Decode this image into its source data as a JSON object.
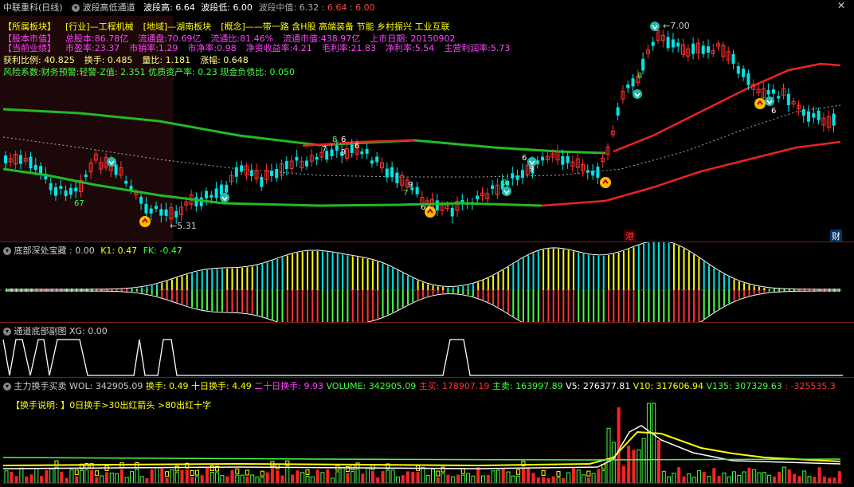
{
  "header": {
    "title": "中联重科(日线)",
    "indicator_name": "波段高低通道",
    "wave_high_label": "波段高:",
    "wave_high_value": "6.64",
    "wave_low_label": "波段低:",
    "wave_low_value": "6.00",
    "wave_mid_label": "波段中值:",
    "wave_mid_value_a": "6.32",
    "wave_mid_sep": ":",
    "wave_mid_value_b": "6.64",
    "wave_mid_sep2": ":",
    "wave_mid_value_c": "6.00"
  },
  "info": {
    "row1": [
      {
        "text": "【所属板块】",
        "color": "#ffff00"
      },
      {
        "text": "[行业]—工程机械",
        "color": "#ffff00"
      },
      {
        "text": "[地域]—湖南板块",
        "color": "#ffff00"
      },
      {
        "text": "[概念]——带一路 含H股 高端装备 节能 乡村振兴 工业互联",
        "color": "#ffff00"
      }
    ],
    "row2": [
      {
        "text": "【股本市值】",
        "color": "#ff44ff"
      },
      {
        "text": "总股本:86.78亿",
        "color": "#ff44ff"
      },
      {
        "text": "流通盘:70.69亿",
        "color": "#ff44ff"
      },
      {
        "text": "流通比:81.46%",
        "color": "#ff44ff"
      },
      {
        "text": "流通市值:438.97亿",
        "color": "#ff44ff"
      },
      {
        "text": "上市日期: 20150902",
        "color": "#ff44ff"
      }
    ],
    "row3": [
      {
        "text": "【当前业绩】",
        "color": "#ff44ff"
      },
      {
        "text": "市盈率:23.37",
        "color": "#ff44ff"
      },
      {
        "text": "市销率:1.29",
        "color": "#ff44ff"
      },
      {
        "text": "市净率:0.98",
        "color": "#ff44ff"
      },
      {
        "text": "净资收益率:4.21",
        "color": "#ff44ff"
      },
      {
        "text": "毛利率:21.83",
        "color": "#ff44ff"
      },
      {
        "text": "净利率:5.54",
        "color": "#ff44ff"
      },
      {
        "text": "主营利润率:5.73",
        "color": "#ff44ff"
      }
    ],
    "row4": [
      {
        "text": "获利比例: 40.825",
        "color": "#ffff88"
      },
      {
        "text": "换手: 0.485",
        "color": "#ffff88"
      },
      {
        "text": "量比: 1.181",
        "color": "#ffff88"
      },
      {
        "text": "涨幅: 0.648",
        "color": "#ffff88"
      }
    ],
    "row5": "风险系数:财务预警:轻警-Z值: 2.351 优质资产率: 0.23 现金负债比: 0.050"
  },
  "main_chart": {
    "high_label": "7.00",
    "low_label": "5.31",
    "badge_hk": "港",
    "badge_cai": "财",
    "digit_labels": [
      "67",
      "6",
      "7",
      "8",
      "9",
      "6",
      "7",
      "9",
      "67",
      "9",
      "6",
      "9",
      "8",
      "6"
    ]
  },
  "panel2": {
    "title": "底部深处宝藏",
    "v0_label": ": 0.00",
    "k1_label": "K1: 0.47",
    "fk_label": "FK: -0.47"
  },
  "panel3": {
    "title": "通道底部副图",
    "xg_label": "XG: 0.00"
  },
  "panel4": {
    "title": "主力换手买卖",
    "items": [
      {
        "text": "WOL: 342905.09",
        "color": "#cccccc"
      },
      {
        "text": "换手: 0.49",
        "color": "#ffff00"
      },
      {
        "text": "十日换手: 4.49",
        "color": "#ffff00"
      },
      {
        "text": "二十日换手: 9.93",
        "color": "#ff44ff"
      },
      {
        "text": "VOLUME: 342905.09",
        "color": "#44ff44"
      },
      {
        "text": "主买: 178907.19",
        "color": "#ff3333"
      },
      {
        "text": "主卖: 163997.89",
        "color": "#44ff44"
      },
      {
        "text": "V5: 276377.81",
        "color": "#ffffff"
      },
      {
        "text": "V10: 317606.94",
        "color": "#ffff00"
      },
      {
        "text": "V135: 307329.63",
        "color": "#44ff44"
      },
      {
        "text": ": -325535.3",
        "color": "#ff3333"
      }
    ],
    "legend_prefix": "【换手说明: 】",
    "legend_text": "0日换手>30出红箭头  >80出红十字"
  },
  "colors": {
    "up": "#ff3333",
    "down": "#00e5e5",
    "green_line": "#22bb22",
    "red_line": "#ee2222"
  }
}
